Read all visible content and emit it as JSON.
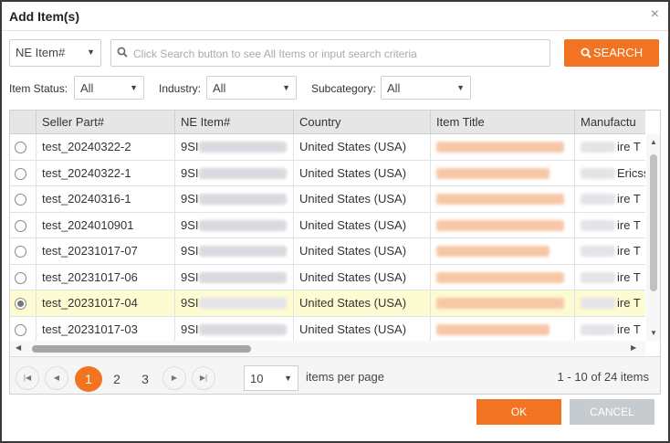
{
  "dialog": {
    "title": "Add Item(s)",
    "close_glyph": "×"
  },
  "search": {
    "type_value": "NE Item#",
    "placeholder": "Click Search button to see All Items or input search criteria",
    "button_label": "SEARCH"
  },
  "filters": {
    "item_status": {
      "label": "Item Status:",
      "value": "All"
    },
    "industry": {
      "label": "Industry:",
      "value": "All"
    },
    "subcategory": {
      "label": "Subcategory:",
      "value": "All"
    }
  },
  "grid": {
    "columns": [
      "Seller Part#",
      "NE Item#",
      "Country",
      "Item Title",
      "Manufactu"
    ],
    "rows": [
      {
        "seller_part": "test_20240322-2",
        "ne_item_prefix": "9SI",
        "country": "United States (USA)",
        "manufacturer_suffix": "ire T",
        "selected": false
      },
      {
        "seller_part": "test_20240322-1",
        "ne_item_prefix": "9SI",
        "country": "United States (USA)",
        "manufacturer_suffix": "Ericss",
        "selected": false
      },
      {
        "seller_part": "test_20240316-1",
        "ne_item_prefix": "9SI",
        "country": "United States (USA)",
        "manufacturer_suffix": "ire T",
        "selected": false
      },
      {
        "seller_part": "test_2024010901",
        "ne_item_prefix": "9SI",
        "country": "United States (USA)",
        "manufacturer_suffix": "ire T",
        "selected": false
      },
      {
        "seller_part": "test_20231017-07",
        "ne_item_prefix": "9SI",
        "country": "United States (USA)",
        "manufacturer_suffix": "ire T",
        "selected": false
      },
      {
        "seller_part": "test_20231017-06",
        "ne_item_prefix": "9SI",
        "country": "United States (USA)",
        "manufacturer_suffix": "ire T",
        "selected": false
      },
      {
        "seller_part": "test_20231017-04",
        "ne_item_prefix": "9SI",
        "country": "United States (USA)",
        "manufacturer_suffix": "ire T",
        "selected": true
      },
      {
        "seller_part": "test_20231017-03",
        "ne_item_prefix": "9SI",
        "country": "United States (USA)",
        "manufacturer_suffix": "ire T",
        "selected": false
      }
    ]
  },
  "pager": {
    "pages": [
      "1",
      "2",
      "3"
    ],
    "current_page": "1",
    "page_size": "10",
    "page_size_label": "items per page",
    "summary": "1 - 10 of 24 items"
  },
  "footer": {
    "ok_label": "OK",
    "cancel_label": "CANCEL"
  },
  "colors": {
    "accent": "#f27321",
    "selected_row": "#fdfbd2",
    "cancel_disabled": "#c6cbd0"
  },
  "icons": [
    "close-icon",
    "search-icon",
    "chevron-down-icon",
    "radio-button",
    "first-page-icon",
    "prev-page-icon",
    "next-page-icon",
    "last-page-icon"
  ]
}
